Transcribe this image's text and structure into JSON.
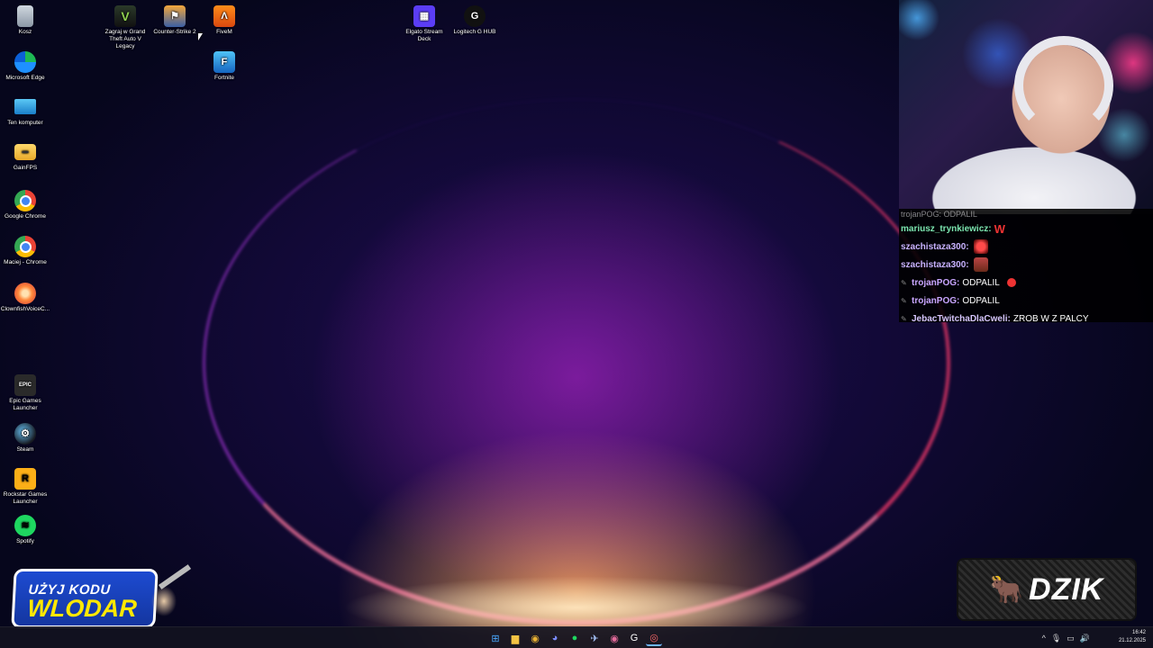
{
  "desktop_icons": [
    {
      "label": "Kosz",
      "icon": "recycle-bin-icon",
      "glyph": ""
    },
    {
      "label": "Microsoft Edge",
      "icon": "edge-icon",
      "glyph": ""
    },
    {
      "label": "Ten komputer",
      "icon": "computer-icon",
      "glyph": ""
    },
    {
      "label": "GainFPS",
      "icon": "folder-icon",
      "glyph": "▬"
    },
    {
      "label": "Google Chrome",
      "icon": "chrome-icon",
      "glyph": ""
    },
    {
      "label": "Maciej - Chrome",
      "icon": "chrome-icon",
      "glyph": ""
    },
    {
      "label": "ClownfishVoiceC...",
      "icon": "clownfish-icon",
      "glyph": ""
    },
    {
      "label": "Epic Games Launcher",
      "icon": "epic-games-icon",
      "glyph": "EPIC"
    },
    {
      "label": "Steam",
      "icon": "steam-icon",
      "glyph": "⚙"
    },
    {
      "label": "Rockstar Games Launcher",
      "icon": "rockstar-icon",
      "glyph": "R"
    },
    {
      "label": "Spotify",
      "icon": "spotify-icon",
      "glyph": "≋"
    },
    {
      "label": "Zagraj w Grand Theft Auto V Legacy",
      "icon": "gta-icon",
      "glyph": "V"
    },
    {
      "label": "Counter-Strike 2",
      "icon": "counter-strike-icon",
      "glyph": "⚑"
    },
    {
      "label": "FiveM",
      "icon": "fivem-icon",
      "glyph": "Λ"
    },
    {
      "label": "Fortnite",
      "icon": "fortnite-icon",
      "glyph": "F"
    },
    {
      "label": "Elgato Stream Deck",
      "icon": "stream-deck-icon",
      "glyph": "▦"
    },
    {
      "label": "Logitech G HUB",
      "icon": "logitech-icon",
      "glyph": "G"
    }
  ],
  "chat": {
    "cut_line": "trojanPOG: ODPALIL",
    "messages": [
      {
        "user": "mariusz_trynkiewicz:",
        "user_color": "#7ce6b0",
        "text": "",
        "emote": "W",
        "badge": ""
      },
      {
        "user": "szachistaza300:",
        "user_color": "#c9b3ff",
        "text": "",
        "emote": "red-emote",
        "badge": ""
      },
      {
        "user": "szachistaza300:",
        "user_color": "#c9b3ff",
        "text": "",
        "emote": "brown-emote",
        "badge": ""
      },
      {
        "user": "trojanPOG:",
        "user_color": "#c9a6ff",
        "text": "ODPALIL",
        "emote": "dot-emote",
        "badge": "✎"
      },
      {
        "user": "trojanPOG:",
        "user_color": "#c9a6ff",
        "text": "ODPALIL",
        "emote": "",
        "badge": "✎"
      },
      {
        "user": "JebacTwitchaDlaCweli:",
        "user_color": "#d8c8ff",
        "text": "ZROB W Z PALCY",
        "emote": "",
        "badge": "✎"
      }
    ]
  },
  "promo": {
    "line1": "UŻYJ KODU",
    "line2": "WLODAR"
  },
  "logo": {
    "word": "DZIK",
    "bull": "🐂"
  },
  "taskbar": {
    "apps": [
      {
        "name": "start-button",
        "glyph": "⊞",
        "color": "#4aa8ff",
        "active": false
      },
      {
        "name": "file-explorer-button",
        "glyph": "▆",
        "color": "#f5c343",
        "active": false
      },
      {
        "name": "chrome-taskbar-button",
        "glyph": "◉",
        "color": "#e9b234",
        "active": false
      },
      {
        "name": "discord-taskbar-button",
        "glyph": "◕",
        "color": "#7b8cff",
        "active": false
      },
      {
        "name": "spotify-taskbar-button",
        "glyph": "●",
        "color": "#1ed760",
        "active": false
      },
      {
        "name": "steam-taskbar-button",
        "glyph": "✈",
        "color": "#aac8ff",
        "active": false
      },
      {
        "name": "chrome-profile-taskbar-button",
        "glyph": "◉",
        "color": "#e36b9b",
        "active": false
      },
      {
        "name": "logitech-taskbar-button",
        "glyph": "G",
        "color": "#ffffff",
        "active": false
      },
      {
        "name": "obs-taskbar-button",
        "glyph": "◎",
        "color": "#ff6a6a",
        "active": true
      }
    ],
    "tray": {
      "chevron": "^",
      "mic": "🎙",
      "network": "▭",
      "volume": "🔊"
    },
    "time": "16:42",
    "date": "21.12.2025"
  }
}
